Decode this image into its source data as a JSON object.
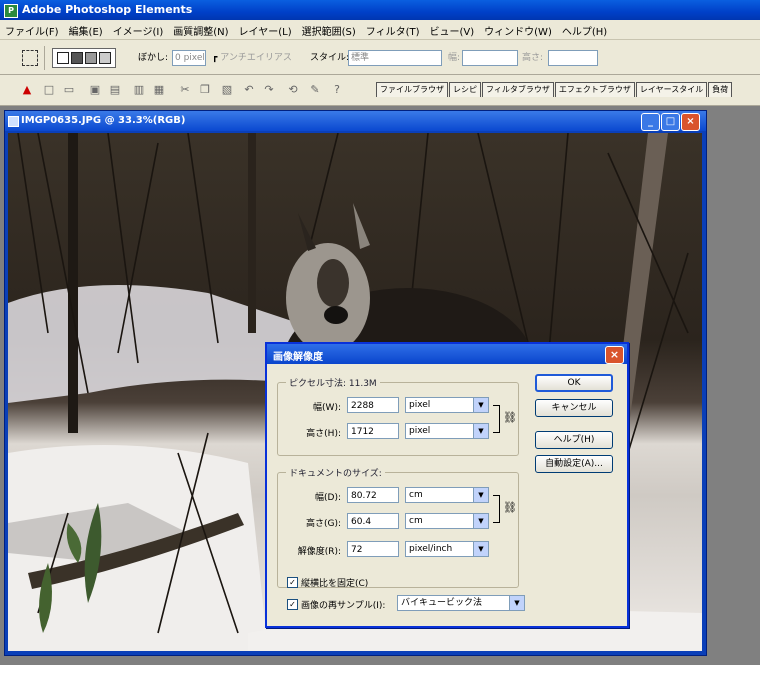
{
  "app": {
    "title": "Adobe Photoshop Elements"
  },
  "menu": [
    "ファイル(F)",
    "編集(E)",
    "イメージ(I)",
    "画質調整(N)",
    "レイヤー(L)",
    "選択範囲(S)",
    "フィルタ(T)",
    "ビュー(V)",
    "ウィンドウ(W)",
    "ヘルプ(H)"
  ],
  "options_bar": {
    "feather_label": "ぼかし:",
    "feather_value": "0 pixel",
    "antialias_label": "アンチエイリアス",
    "style_label": "スタイル:",
    "style_value": "標準",
    "width_label": "幅:",
    "height_label": "高さ:"
  },
  "palette_tabs": [
    "ファイルブラウザ",
    "レシピ",
    "フィルタブラウザ",
    "エフェクトブラウザ",
    "レイヤースタイル",
    "負荷"
  ],
  "document": {
    "title": "IMGP0635.JPG @ 33.3%(RGB)"
  },
  "dialog": {
    "title": "画像解像度",
    "pixel_group": "ピクセル寸法: 11.3M",
    "doc_group": "ドキュメントのサイズ:",
    "px_width_label": "幅(W):",
    "px_width_value": "2288",
    "px_width_unit": "pixel",
    "px_height_label": "高さ(H):",
    "px_height_value": "1712",
    "px_height_unit": "pixel",
    "doc_width_label": "幅(D):",
    "doc_width_value": "80.72",
    "doc_width_unit": "cm",
    "doc_height_label": "高さ(G):",
    "doc_height_value": "60.4",
    "doc_height_unit": "cm",
    "resolution_label": "解像度(R):",
    "resolution_value": "72",
    "resolution_unit": "pixel/inch",
    "constrain_label": "縦横比を固定(C)",
    "resample_label": "画像の再サンプル(I):",
    "resample_value": "バイキュービック法",
    "ok_label": "OK",
    "cancel_label": "キャンセル",
    "help_label": "ヘルプ(H)",
    "auto_label": "自動設定(A)..."
  }
}
